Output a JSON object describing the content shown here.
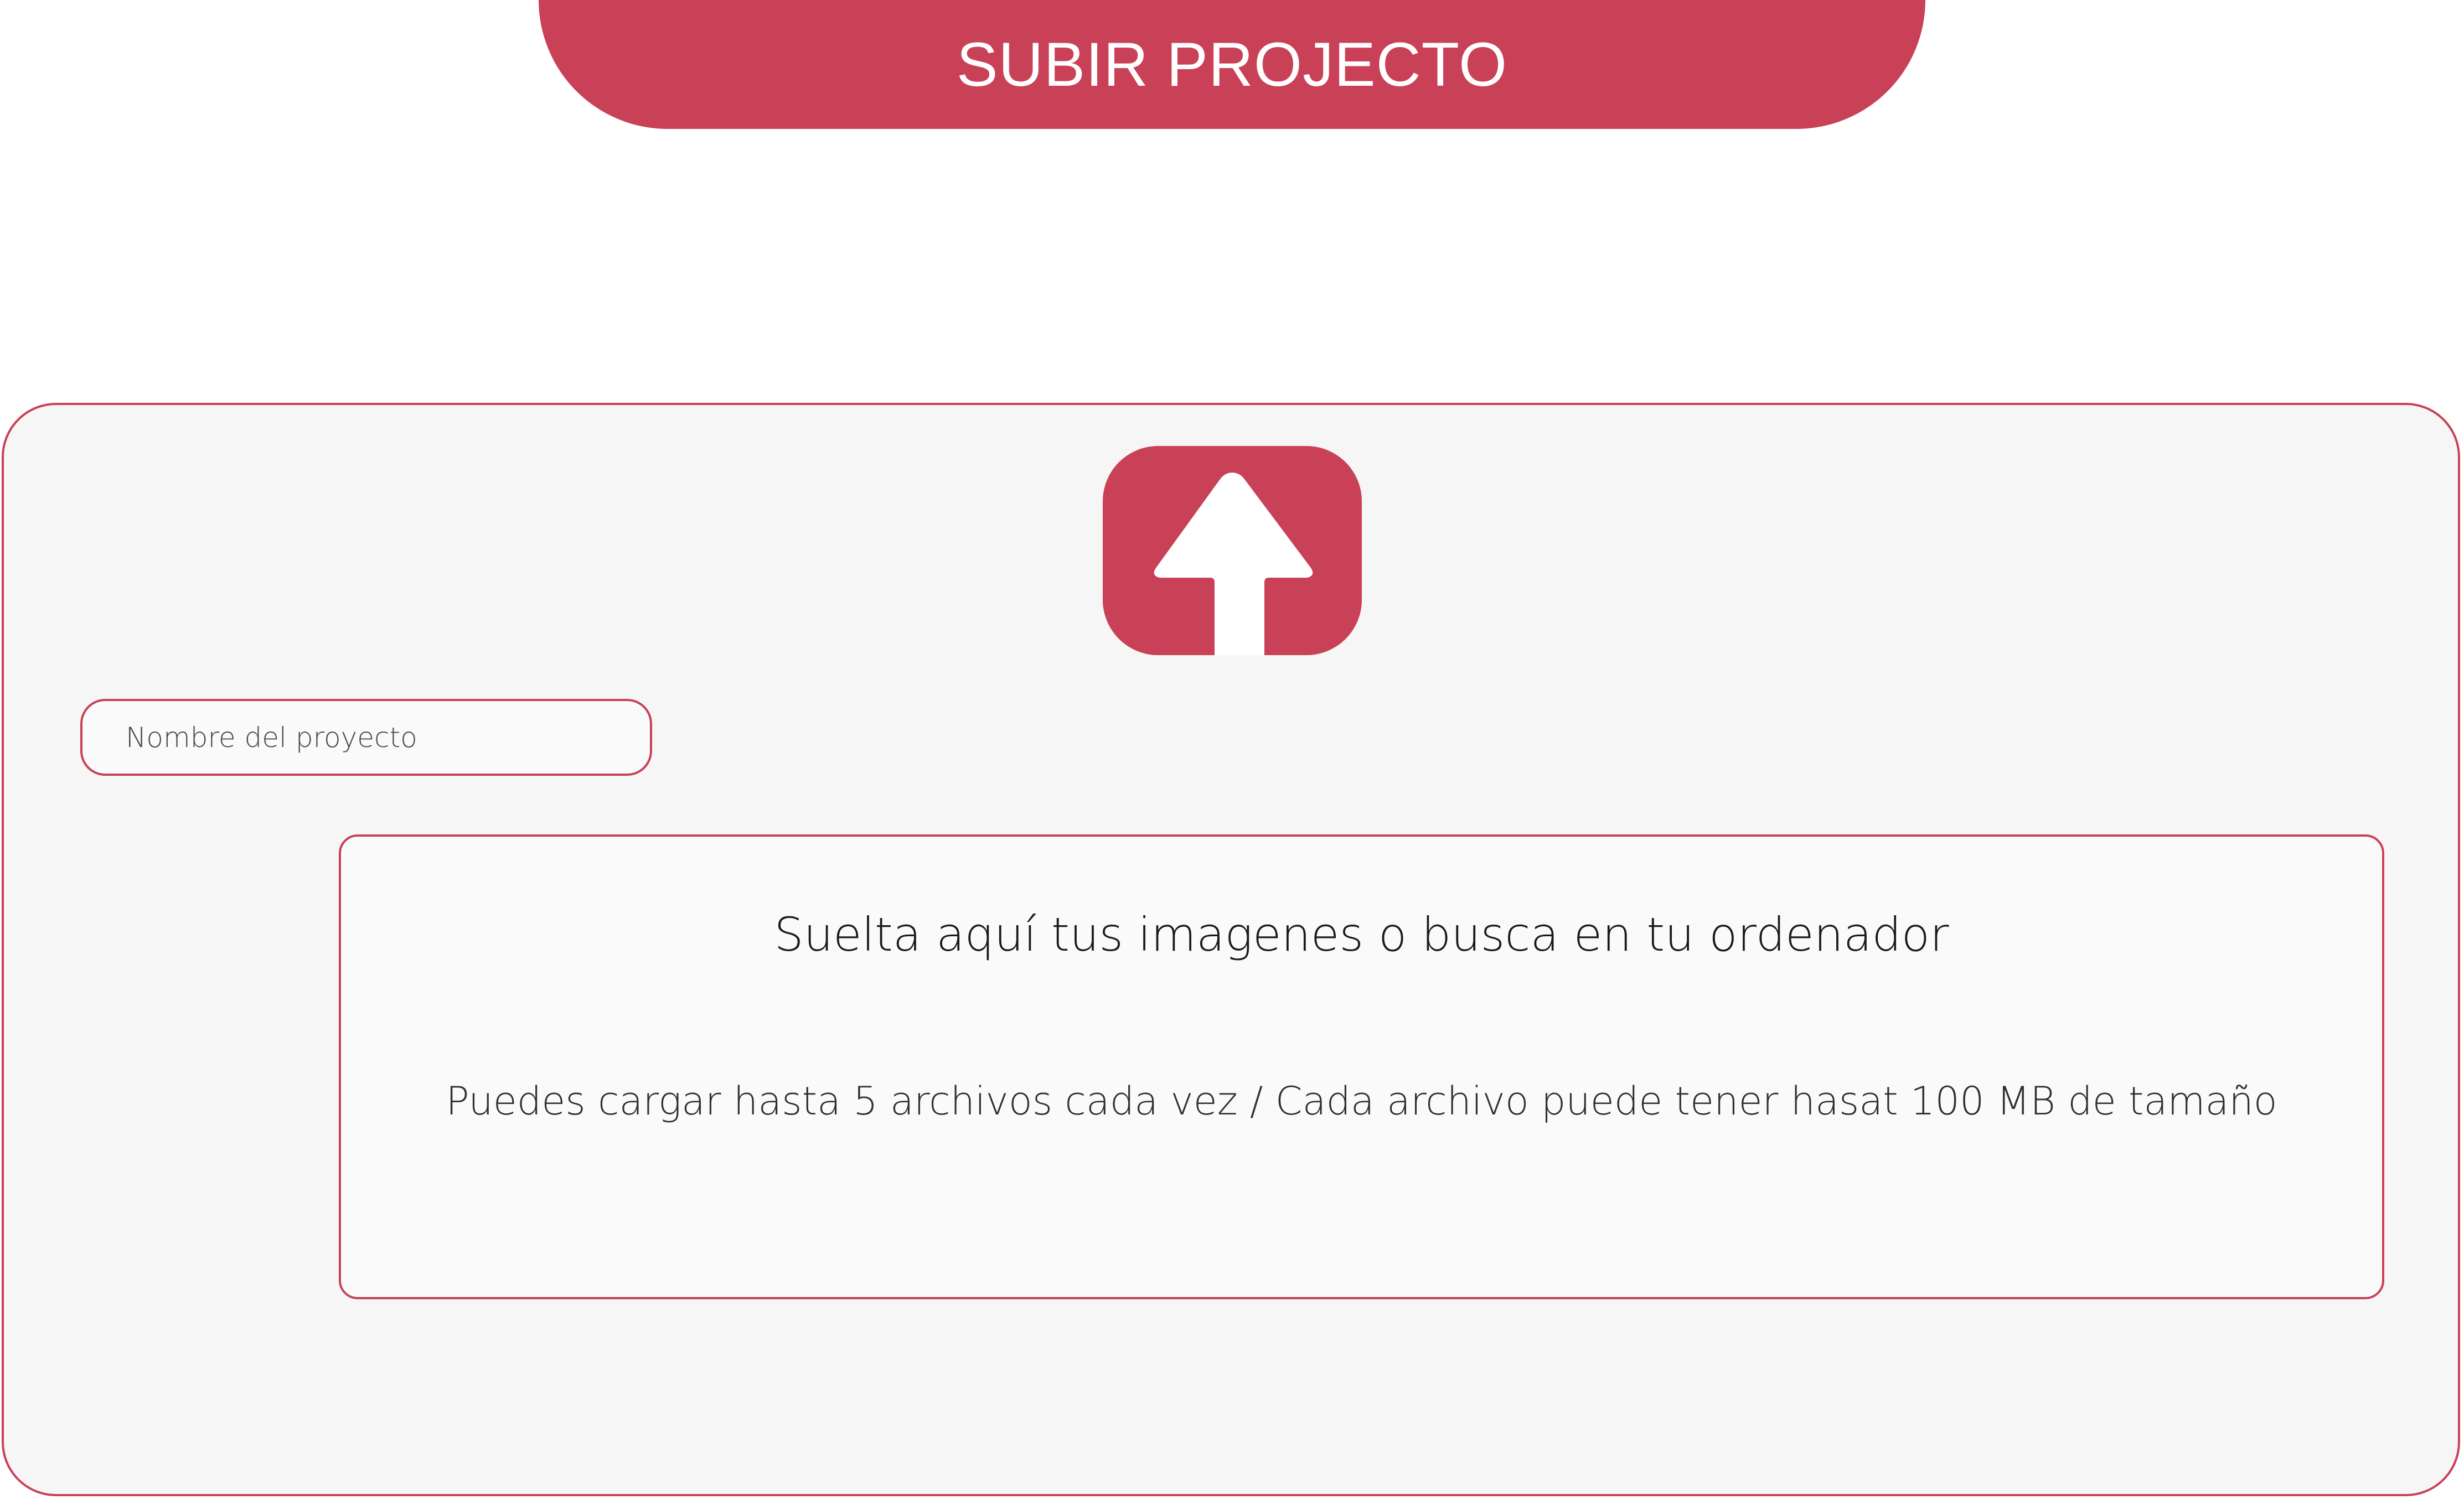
{
  "header": {
    "title": "SUBIR PROJECTO"
  },
  "upload": {
    "icon": "upload-arrow-icon",
    "project_name_placeholder": "Nombre del proyecto",
    "project_name_value": "",
    "dropzone_title": "Suelta aquí tus imagenes o busca en tu ordenador",
    "dropzone_hint": "Puedes cargar hasta 5 archivos cada vez / Cada archivo puede tener hasat 100 MB de tamaño"
  },
  "colors": {
    "accent": "#c94157",
    "panel_background": "#f6f6f6",
    "dropzone_background": "#fafafa",
    "page_background": "#ffffff"
  }
}
